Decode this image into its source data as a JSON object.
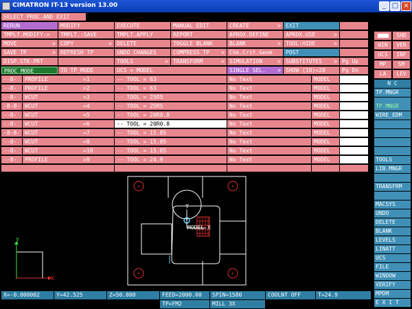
{
  "window": {
    "title": "CIMATRON IT-13 version 13.00",
    "min_icon": "minimize-icon",
    "max_icon": "maximize-icon",
    "close_icon": "close-icon"
  },
  "menu": {
    "row0": {
      "c0": "SELECT PROC.AND EXIT"
    },
    "row1": {
      "c0": "RERUN",
      "c1": "MODIFY",
      "c2": "EXECUTE",
      "c3": "MANUAL EDIT",
      "c4": "CREATE",
      "c5": "EXIT"
    },
    "row2": {
      "c0": "TMPLT.MODIFY->",
      "c1": "TMPLT.:SAVE",
      "c2": "TMPLT.APPLY",
      "c3": "REPORT",
      "c4": "APROX.DEFINE",
      "c5": "APROX.USE"
    },
    "row3": {
      "c0": "MOVE",
      "c1": "COPY",
      "c2": "DELETE",
      "c3": "TOGGLE BLANK",
      "c4": "BLANK",
      "c5": "TOOL:HIDE"
    },
    "row4": {
      "c0": "SAVE TP",
      "c1": "REFRESH TP",
      "c2": "UNDO CHANGES",
      "c3": "COMPRESS TP",
      "c4": "Chk.Crit.Geom",
      "c5": "POST"
    },
    "row5": {
      "c0": "DISP.STK-PRT",
      "c2": "TOOLS",
      "c3": "TRANSFORM",
      "c4": "SIMULATION",
      "c5": "SUBSTITUTES",
      "c6": "Pg Up"
    },
    "row6": {
      "c0": "PROC_MODE",
      "c1": "TO TP_MODE",
      "c2": "UCS = MODEL",
      "c4": "SINGLE SEL.",
      "c5": "SHOW (10)=20",
      "c6": "Pg Dn"
    },
    "arrow": ">"
  },
  "procedures": [
    {
      "num": "--8-",
      "name": "PROFILE",
      "idx": "=1",
      "tool": "-- TOOL = 63",
      "text": "No Text",
      "model": "MODEL"
    },
    {
      "num": "--8-",
      "name": "PROFILE",
      "idx": "=2",
      "tool": "-- TOOL = 63",
      "text": "No Text",
      "model": "MODEL"
    },
    {
      "num": "--8-",
      "name": "WCUT",
      "idx": "=3",
      "tool": "-- TOOL = 25R5",
      "text": "No Text",
      "model": "MODEL"
    },
    {
      "num": "-8-8-",
      "name": "WCUT",
      "idx": "=4",
      "tool": "-- TOOL = 25R5",
      "text": "No Text",
      "model": "MODEL"
    },
    {
      "num": "--8-",
      "name": "WCUT",
      "idx": "=5",
      "tool": "-- TOOL = 20R0.8",
      "text": "No Text",
      "model": "MODEL"
    },
    {
      "num": "--8-",
      "name": "WCUT",
      "idx": "=6",
      "tool": "-- TOOL = 20R0.8",
      "text": "No Text",
      "model": "MODEL"
    },
    {
      "num": "-8-8-",
      "name": "WCUT",
      "idx": "=7",
      "tool": "-- TOOL = 15.85",
      "text": "No Text",
      "model": "MODEL"
    },
    {
      "num": "--8-",
      "name": "WCUT",
      "idx": "=8",
      "tool": "-- TOOL = 15.85",
      "text": "No Text",
      "model": "MODEL"
    },
    {
      "num": "--8-",
      "name": "WCUT",
      "idx": "=10",
      "tool": "-- TOOL = 15.85",
      "text": "No Text",
      "model": "MODEL"
    },
    {
      "num": "--8-",
      "name": "PROFILE",
      "idx": "=9",
      "tool": "-- TOOL = 24.9",
      "text": "No Text",
      "model": "MODEL"
    }
  ],
  "sidebar": {
    "shd": "SHD",
    "win": "WIN",
    "ver": "VER",
    "ucs": "UCS",
    "inf": "INF",
    "mp": "MP",
    "sm": "SM",
    "la": "LA",
    "lev": "LEV",
    "nc": "N C",
    "tp_mngr": "TP.MNGR",
    "tp_mngr2": "TP.MNGR",
    "wire_edm": "WIRE_EDM",
    "tools": "TOOLS",
    "lib_mngr": "LIB.MNGR",
    "transfrm": "TRANSFRM",
    "macsys": "MACSYS",
    "undo": "UNDO",
    "delete": "DELETE",
    "blank": "BLANK",
    "levels": "LEVELS",
    "linatt": "LINATT",
    "ucs2": "UCS",
    "file": "FILE",
    "window": "WINDOW",
    "verify": "VERIFY",
    "mpdm": "MPDM",
    "exit": "E X I T"
  },
  "viewport": {
    "axis_y": "Y",
    "axis_x": "X",
    "model_y": "Y",
    "model_label": "MODEL",
    "model_x": "X"
  },
  "status": {
    "x": "X=-0.000002",
    "y": "Y=42.525",
    "z": "Z=50.000",
    "feed": "FEED=2000.00",
    "spin": "SPIN=1580",
    "coolnt": "COOLNT OFF",
    "t": "T=24.9",
    "tp": "TP=FM2",
    "mill": "MILL 3X"
  }
}
